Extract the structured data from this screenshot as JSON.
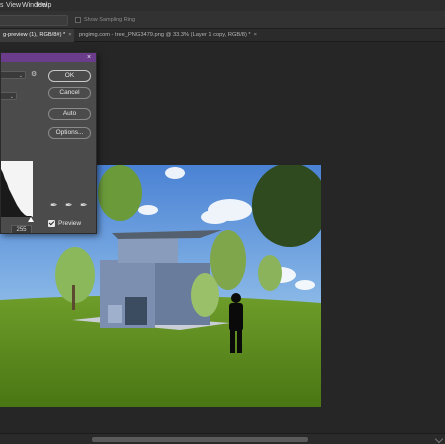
{
  "menubar": {
    "items": [
      "s",
      "View",
      "Window",
      "Help"
    ]
  },
  "options_bar": {
    "checkbox_label": "Show Sampling Ring"
  },
  "tabs": [
    {
      "label": "g-preview (1), RGB/8#) *",
      "close": "×"
    },
    {
      "label": "pngimg.com - tree_PNG3479.png @ 33.3% (Layer 1 copy, RGB/8) *",
      "close": "×"
    }
  ],
  "levels_dialog": {
    "close": "×",
    "buttons": {
      "ok": "OK",
      "cancel": "Cancel",
      "auto": "Auto",
      "options": "Options..."
    },
    "input_white": "255",
    "output_white": "255",
    "preview_label": "Preview",
    "preview_checked": true
  },
  "colors": {
    "accent_titlebar": "#6b3c8c",
    "sky_top": "#5b8fd6",
    "grass": "#5c8a1a"
  }
}
